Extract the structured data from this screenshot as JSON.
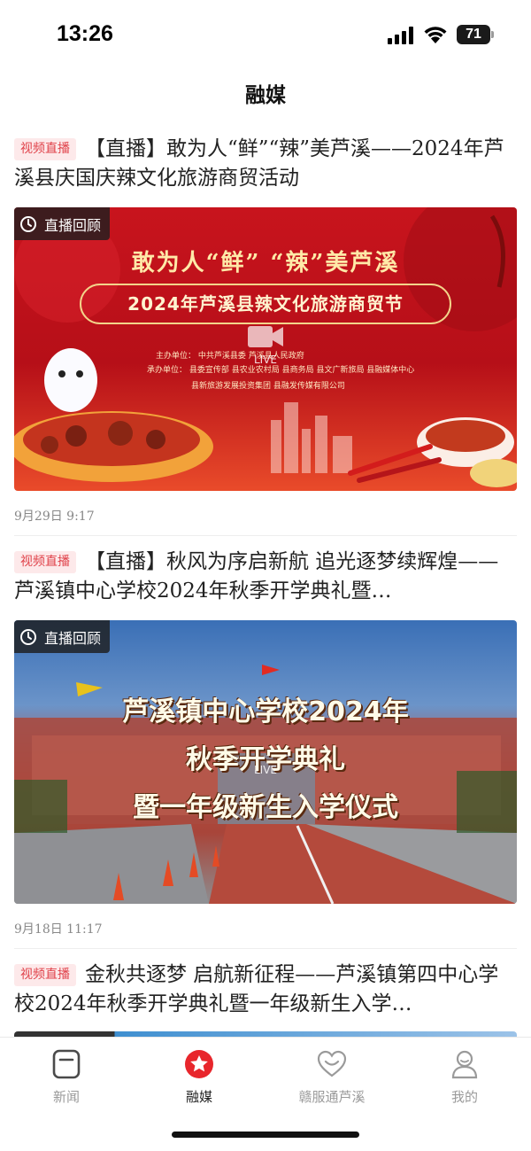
{
  "status_bar": {
    "time": "13:26",
    "battery_level": "71",
    "icons": [
      "signal-icon",
      "wifi-icon",
      "battery-icon"
    ]
  },
  "header": {
    "title": "融媒"
  },
  "feed": [
    {
      "tag": "视频直播",
      "title": "【直播】敢为人“鲜”“辣”美芦溪——2024年芦溪县庆国庆辣文化旅游商贸活动",
      "badge": "直播回顾",
      "live_label": "LIVE",
      "date": "9月29日  9:17",
      "thumbnail": {
        "slogan": "敢为人“鲜”  “辣”美芦溪",
        "banner": "2024年芦溪县辣文化旅游商贸节",
        "org_line_1": "主办单位：  中共芦溪县委   芦溪县人民政府",
        "org_line_2": "承办单位：  县委宣传部   县农业农村局   县商务局   县文广新旅局   县融媒体中心",
        "org_line_3": "县新旅游发展投资集团   县融发传媒有限公司"
      }
    },
    {
      "tag": "视频直播",
      "title": "【直播】秋风为序启新航    追光逐梦续辉煌——芦溪镇中心学校2024年秋季开学典礼暨…",
      "badge": "直播回顾",
      "live_label": "LIVE",
      "date": "9月18日  11:17",
      "thumbnail": {
        "line_1": "芦溪镇中心学校2024年",
        "line_2": "秋季开学典礼",
        "line_3": "暨一年级新生入学仪式"
      }
    },
    {
      "tag": "视频直播",
      "title": "金秋共逐梦  启航新征程——芦溪镇第四中心学校2024年秋季开学典礼暨一年级新生入学…"
    }
  ],
  "tab_bar": {
    "active": "融媒",
    "accent_color": "#e8262c",
    "tabs": [
      {
        "label": "新闻",
        "icon": "news-icon"
      },
      {
        "label": "融媒",
        "icon": "media-star-icon"
      },
      {
        "label": "赣服通芦溪",
        "icon": "heart-service-icon"
      },
      {
        "label": "我的",
        "icon": "user-icon"
      }
    ]
  }
}
